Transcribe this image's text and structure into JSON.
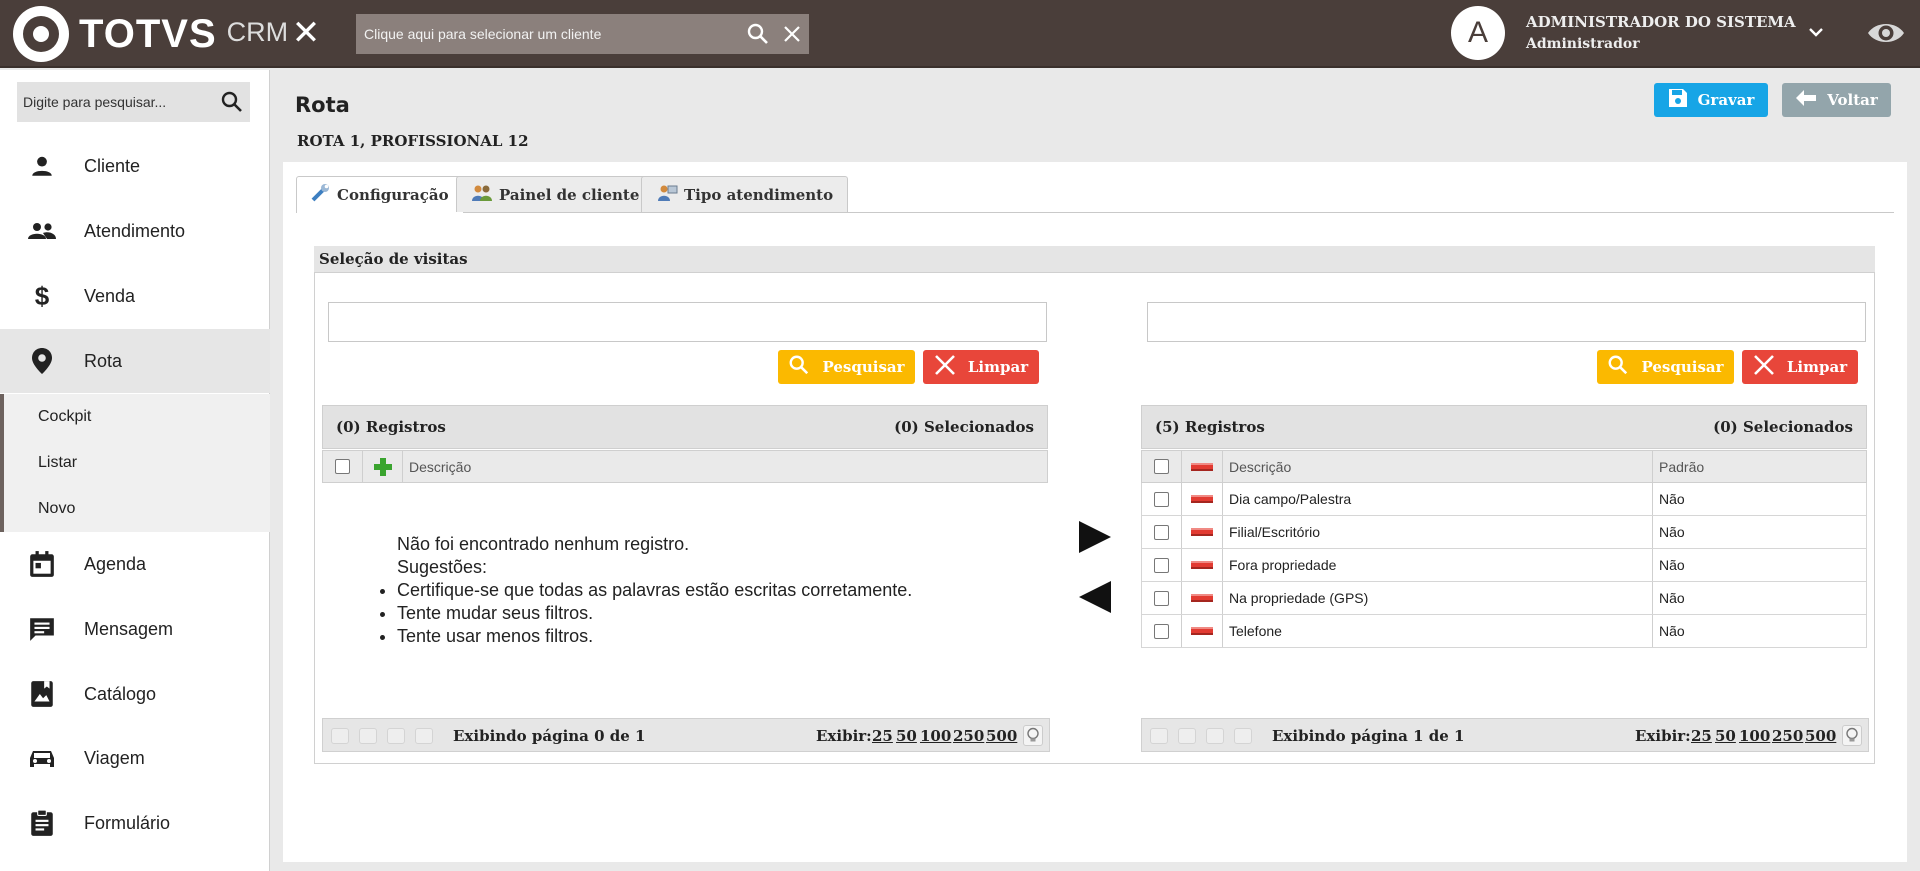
{
  "header": {
    "logo_text": "TOTVS",
    "logo_suffix": "CRM",
    "client_search_placeholder": "Clique aqui para selecionar um cliente",
    "avatar_letter": "A",
    "user_name": "ADMINISTRADOR DO SISTEMA",
    "user_role": "Administrador"
  },
  "sidebar": {
    "search_placeholder": "Digite para pesquisar...",
    "items": [
      {
        "label": "Cliente",
        "icon": "person-icon"
      },
      {
        "label": "Atendimento",
        "icon": "people-icon"
      },
      {
        "label": "Venda",
        "icon": "dollar-icon"
      },
      {
        "label": "Rota",
        "icon": "location-pin-icon"
      },
      {
        "label": "Agenda",
        "icon": "calendar-icon"
      },
      {
        "label": "Mensagem",
        "icon": "message-icon"
      },
      {
        "label": "Catálogo",
        "icon": "catalog-icon"
      },
      {
        "label": "Viagem",
        "icon": "car-icon"
      },
      {
        "label": "Formulário",
        "icon": "clipboard-icon"
      }
    ],
    "submenu": [
      "Cockpit",
      "Listar",
      "Novo"
    ]
  },
  "page": {
    "title": "Rota",
    "subtitle": "ROTA 1, PROFISSIONAL 12",
    "save_label": "Gravar",
    "back_label": "Voltar"
  },
  "tabs": [
    {
      "label": "Configuração",
      "active": true
    },
    {
      "label": "Painel de cliente",
      "active": false
    },
    {
      "label": "Tipo atendimento",
      "active": false
    }
  ],
  "section": {
    "title": "Seleção de visitas",
    "search_label": "Pesquisar",
    "clear_label": "Limpar"
  },
  "left_grid": {
    "records": "(0) Registros",
    "selected": "(0) Selecionados",
    "col_descricao": "Descrição",
    "empty_title": "Não foi encontrado nenhum registro.",
    "empty_suggestions_label": "Sugestões:",
    "suggestions": [
      "Certifique-se que todas as palavras estão escritas corretamente.",
      "Tente mudar seus filtros.",
      "Tente usar menos filtros."
    ],
    "pager_info": "Exibindo página 0 de 1"
  },
  "right_grid": {
    "records": "(5) Registros",
    "selected": "(0) Selecionados",
    "col_descricao": "Descrição",
    "col_padrao": "Padrão",
    "rows": [
      {
        "descricao": "Dia campo/Palestra",
        "padrao": "Não"
      },
      {
        "descricao": "Filial/Escritório",
        "padrao": "Não"
      },
      {
        "descricao": "Fora propriedade",
        "padrao": "Não"
      },
      {
        "descricao": "Na propriedade (GPS)",
        "padrao": "Não"
      },
      {
        "descricao": "Telefone",
        "padrao": "Não"
      }
    ],
    "pager_info": "Exibindo página 1 de 1"
  },
  "pager": {
    "exibir_label": "Exibir:",
    "sizes": [
      "25",
      "50",
      "100",
      "250",
      "500"
    ]
  },
  "colors": {
    "topbar": "#4a3e3a",
    "save_button": "#17a5e6",
    "back_button": "#93a5ab",
    "search_button": "#fbb900",
    "clear_button": "#e8463a"
  }
}
